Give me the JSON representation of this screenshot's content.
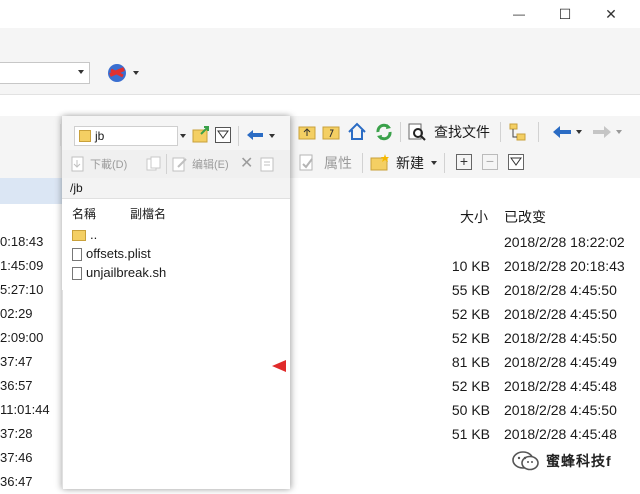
{
  "window": {
    "minimize": "—",
    "maximize": "☐",
    "close": "✕"
  },
  "left_list": {
    "times": [
      "0:18:43",
      "1:45:09",
      "5:27:10",
      "02:29",
      "2:09:00",
      "37:47",
      "36:57",
      "11:01:44",
      "37:28",
      "37:46",
      "36:47"
    ]
  },
  "dialog": {
    "combo_value": "jb",
    "download_label": "下載(D)",
    "edit_label": "编辑(E)",
    "path": "/jb",
    "col_name": "名稱",
    "col_ext": "副檔名",
    "items": [
      {
        "name": "..",
        "kind": "parent"
      },
      {
        "name": "offsets.plist",
        "kind": "file"
      },
      {
        "name": "unjailbreak.sh",
        "kind": "file"
      }
    ]
  },
  "right_toolbar": {
    "find_files": "查找文件",
    "properties": "属性",
    "new": "新建"
  },
  "table": {
    "col_size": "大小",
    "col_modified": "已改变",
    "rows": [
      {
        "size": "",
        "date": "2018/2/28 18:22:02"
      },
      {
        "size": "10 KB",
        "date": "2018/2/28 20:18:43"
      },
      {
        "size": "55 KB",
        "date": "2018/2/28 4:45:50"
      },
      {
        "size": "52 KB",
        "date": "2018/2/28 4:45:50"
      },
      {
        "size": "52 KB",
        "date": "2018/2/28 4:45:50"
      },
      {
        "size": "81 KB",
        "date": "2018/2/28 4:45:49"
      },
      {
        "size": "52 KB",
        "date": "2018/2/28 4:45:48"
      },
      {
        "size": "50 KB",
        "date": "2018/2/28 4:45:50"
      },
      {
        "size": "51 KB",
        "date": "2018/2/28 4:45:48"
      }
    ]
  },
  "watermark": {
    "text": "蜜蜂科技f"
  },
  "colors": {
    "header_blue": "#dbe6f4",
    "accent_red": "#e02a2a",
    "refresh_green": "#3aa14a"
  }
}
